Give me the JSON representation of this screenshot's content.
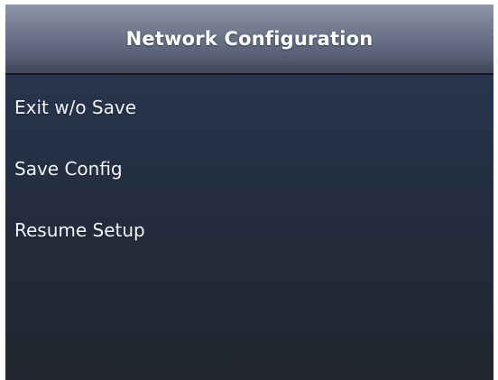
{
  "header": {
    "title": "Network Configuration"
  },
  "menu": {
    "items": [
      {
        "label": "Exit w/o Save"
      },
      {
        "label": "Save Config"
      },
      {
        "label": "Resume Setup"
      }
    ]
  },
  "colors": {
    "header_top": "#8e97a9",
    "header_bottom": "#3f4859",
    "background_top": "#2c3a55",
    "background_bottom": "#22272f",
    "text": "#ffffff"
  }
}
